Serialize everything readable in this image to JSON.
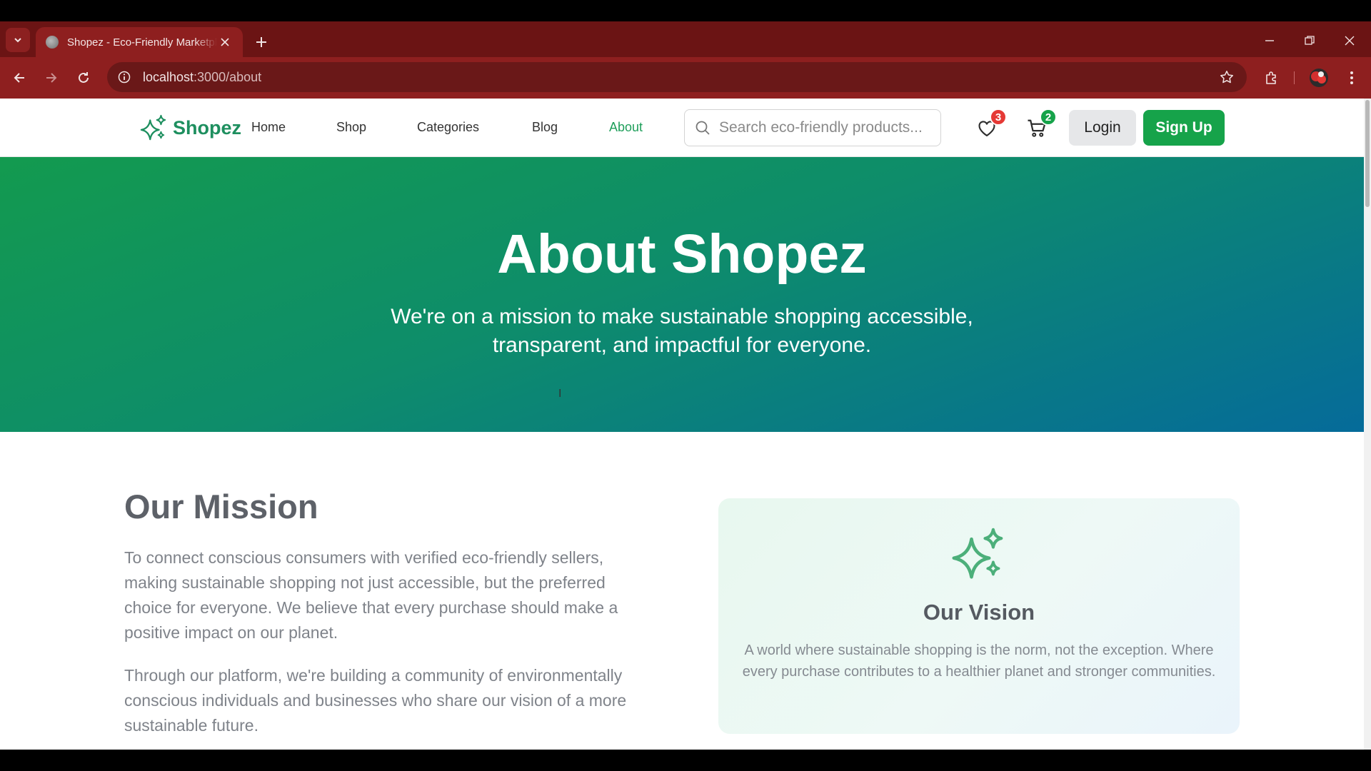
{
  "browser": {
    "tab_title": "Shopez - Eco-Friendly Marketplace",
    "url_host": "localhost",
    "url_path": ":3000/about"
  },
  "header": {
    "logo_text": "Shopez",
    "nav": [
      {
        "label": "Home"
      },
      {
        "label": "Shop"
      },
      {
        "label": "Categories"
      },
      {
        "label": "Blog"
      },
      {
        "label": "About"
      }
    ],
    "search_placeholder": "Search eco-friendly products...",
    "wishlist_count": "3",
    "cart_count": "2",
    "login_label": "Login",
    "signup_label": "Sign Up"
  },
  "hero": {
    "title": "About Shopez",
    "subtitle": "We're on a mission to make sustainable shopping accessible, transparent, and impactful for everyone."
  },
  "mission": {
    "title": "Our Mission",
    "paragraphs": [
      "To connect conscious consumers with verified eco-friendly sellers, making sustainable shopping not just accessible, but the preferred choice for everyone. We believe that every purchase should make a positive impact on our planet.",
      "Through our platform, we're building a community of environmentally conscious individuals and businesses who share our vision of a more sustainable future."
    ]
  },
  "vision": {
    "title": "Our Vision",
    "text": "A world where sustainable shopping is the norm, not the exception. Where every purchase contributes to a healthier planet and stronger communities."
  },
  "colors": {
    "brand_green": "#16a34a",
    "browser_frame": "#8e1f1f",
    "hero_start": "#139a4f",
    "hero_end": "#056b9a"
  },
  "icons": [
    "tab-list-icon",
    "globe-icon",
    "close-icon",
    "plus-icon",
    "minimize-icon",
    "restore-icon",
    "back-icon",
    "forward-icon",
    "reload-icon",
    "site-info-icon",
    "bookmark-star-icon",
    "extensions-icon",
    "profile-avatar",
    "more-menu-icon",
    "sparkles-icon",
    "search-icon",
    "heart-icon",
    "cart-icon"
  ]
}
